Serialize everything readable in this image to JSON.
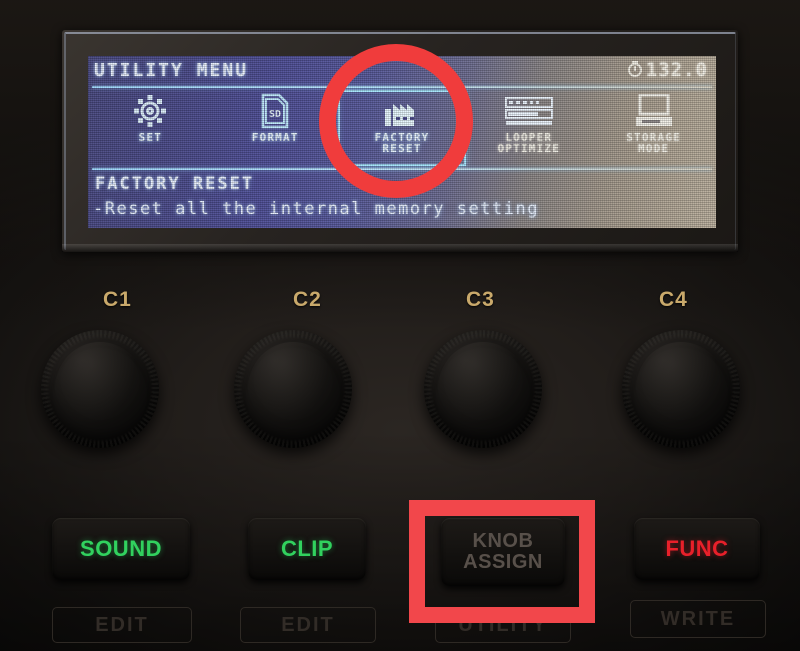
{
  "device": {
    "screen": {
      "header": {
        "title": "UTILITY MENU",
        "tempo_icon": "power-clock-icon",
        "tempo_value": "132.0"
      },
      "menu_items": [
        {
          "label": "SET",
          "icon": "gear-icon",
          "selected": false
        },
        {
          "label": "FORMAT",
          "icon": "sd-card-icon",
          "selected": false
        },
        {
          "label": "FACTORY\nRESET",
          "icon": "factory-icon",
          "selected": true
        },
        {
          "label": "LOOPER\nOPTIMIZE",
          "icon": "bars-icon",
          "selected": false
        },
        {
          "label": "STORAGE\nMODE",
          "icon": "computer-icon",
          "selected": false
        }
      ],
      "description": {
        "title": "FACTORY RESET",
        "body": "-Reset all the internal memory setting"
      }
    },
    "knob_labels": [
      "C1",
      "C2",
      "C3",
      "C4"
    ],
    "buttons": [
      {
        "label": "SOUND",
        "sublabel": "EDIT",
        "color": "#31d15e"
      },
      {
        "label": "CLIP",
        "sublabel": "EDIT",
        "color": "#31d15e"
      },
      {
        "label": "KNOB\nASSIGN",
        "sublabel": "UTILITY",
        "color": "#58504a"
      },
      {
        "label": "FUNC",
        "sublabel": "WRITE",
        "color": "#e8202a"
      }
    ],
    "annotations": {
      "circle_target": "FACTORY RESET",
      "rect_target": "KNOB ASSIGN",
      "color": "#f03c3c"
    }
  }
}
